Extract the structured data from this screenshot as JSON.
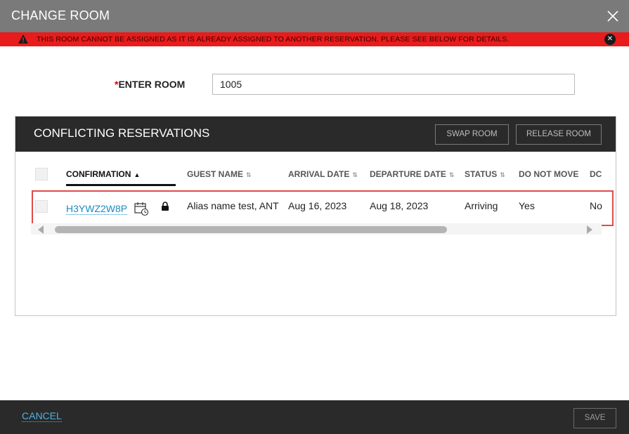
{
  "dialog": {
    "title": "CHANGE ROOM"
  },
  "alert": {
    "message": "THIS ROOM CANNOT BE ASSIGNED AS IT IS ALREADY ASSIGNED TO ANOTHER RESERVATION. PLEASE SEE BELOW FOR DETAILS.",
    "color": "#e81c1c"
  },
  "room": {
    "required_mark": "*",
    "label": "ENTER ROOM",
    "value": "1005"
  },
  "conflicts": {
    "title": "CONFLICTING RESERVATIONS",
    "swap_label": "SWAP ROOM",
    "release_label": "RELEASE ROOM",
    "columns": {
      "confirmation": "CONFIRMATION",
      "guest_name": "GUEST NAME",
      "arrival_date": "ARRIVAL DATE",
      "departure_date": "DEPARTURE DATE",
      "status": "STATUS",
      "do_not_move": "DO NOT MOVE",
      "truncated": "DC"
    },
    "sorted_column": "confirmation",
    "rows": [
      {
        "confirmation": "H3YWZ2W8P",
        "guest_name": "Alias name test, ANT",
        "arrival_date": "Aug 16, 2023",
        "departure_date": "Aug 18, 2023",
        "status": "Arriving",
        "do_not_move": "Yes",
        "truncated": "No"
      }
    ]
  },
  "footer": {
    "cancel_label": "CANCEL",
    "save_label": "SAVE"
  },
  "colors": {
    "link": "#1a8bc3",
    "header_bg": "#2a2a2a",
    "titlebar_bg": "#7a7a7a",
    "row_highlight": "#e04a4a"
  }
}
